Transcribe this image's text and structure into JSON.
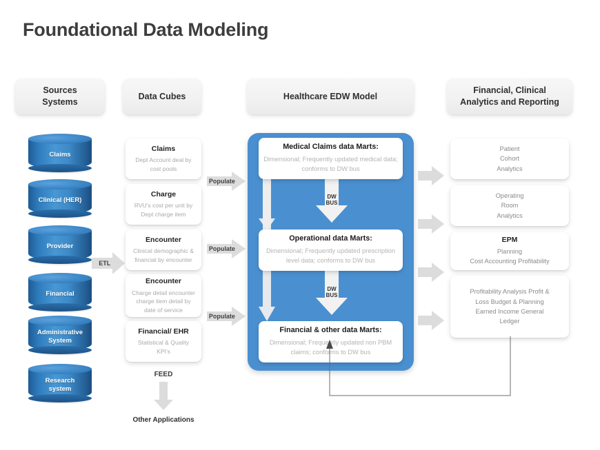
{
  "title": "Foundational Data Modeling",
  "colors": {
    "cylinder_blue": "#2f7cbc",
    "panel_blue": "#4a90d0",
    "arrow_grey": "#d9d9d9",
    "title_grey": "#3d3d3d",
    "muted_text": "#a9a9a9"
  },
  "headers": [
    {
      "label": "Sources\nSystems",
      "line1": "Sources",
      "line2": "Systems"
    },
    {
      "label": "Data Cubes",
      "line1": "Data Cubes",
      "line2": ""
    },
    {
      "label": "Healthcare EDW Model",
      "line1": "Healthcare EDW Model",
      "line2": ""
    },
    {
      "label": "Financial, Clinical Analytics and Reporting",
      "line1": "Financial, Clinical",
      "line2": "Analytics and Reporting"
    }
  ],
  "sources": {
    "items": [
      {
        "label": "Claims"
      },
      {
        "label": "Clinical (HER)"
      },
      {
        "label": "Provider"
      },
      {
        "label": "Financial"
      },
      {
        "label": "Administrative\nSystem",
        "line1": "Administrative",
        "line2": "System"
      },
      {
        "label": "Research\nsystem",
        "line1": "Research",
        "line2": "system"
      }
    ]
  },
  "data_cubes": {
    "items": [
      {
        "title": "Claims",
        "desc": "Dept Account deal by cost pools"
      },
      {
        "title": "Charge",
        "desc": "RVU's cost per unit by Dept charge item"
      },
      {
        "title": "Encounter",
        "desc": "Clinical demographic & financial by encounter"
      },
      {
        "title": "Encounter",
        "desc": "Charge detail encounter charge item detail by date of service"
      },
      {
        "title": "Financial/ EHR",
        "desc": "Statistical & Quality KPI's"
      }
    ],
    "feed_label": "FEED",
    "other_applications": "Other Applications"
  },
  "edw": {
    "marts": [
      {
        "title": "Medical Claims data Marts:",
        "desc": "Dimensional; Frequently updated medical data; conforms to DW bus"
      },
      {
        "title": "Operational data Marts:",
        "desc": "Dimensional; Frequently updated prescription level data; conforms to DW bus"
      },
      {
        "title": "Financial & other data Marts:",
        "desc": "Dimensional; Frequently updated non PBM claims; conforms to DW bus"
      }
    ],
    "bus_arrows": [
      {
        "line1": "DW",
        "line2": "BUS"
      },
      {
        "line1": "DW",
        "line2": "BUS"
      }
    ]
  },
  "analytics": {
    "items": [
      {
        "title": "",
        "desc": "Patient Cohort Analytics",
        "lines": [
          "Patient",
          "Cohort",
          "Analytics"
        ]
      },
      {
        "title": "",
        "desc": "Operating Room Analytics",
        "lines": [
          "Operating",
          "Room",
          "Analytics"
        ]
      },
      {
        "title": "EPM",
        "desc": "Planning Cost Accounting Profitability",
        "lines": [
          "Planning",
          "Cost Accounting  Profitability"
        ]
      },
      {
        "title": "",
        "desc": "Profitability Analysis Profit & Loss Budget & Planning Earned Income General Ledger",
        "lines": [
          "Profitability Analysis Profit &",
          "Loss Budget & Planning",
          "Earned Income General",
          "Ledger"
        ]
      }
    ]
  },
  "connectors": {
    "etl": "ETL",
    "populate": [
      "Populate",
      "Populate",
      "Populate"
    ]
  }
}
